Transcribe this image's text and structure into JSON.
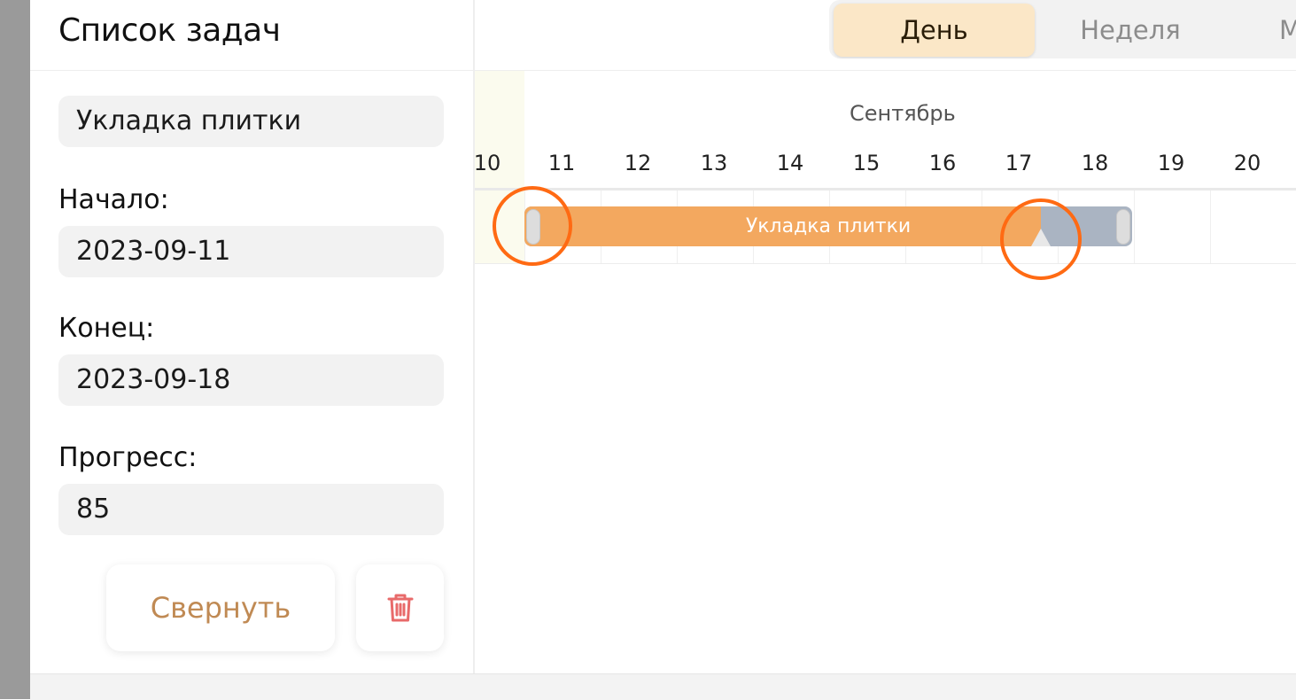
{
  "sidebar": {
    "title": "Список задач",
    "task_name": "Укладка плитки",
    "start_label": "Начало:",
    "start_value": "2023-09-11",
    "end_label": "Конец:",
    "end_value": "2023-09-18",
    "progress_label": "Прогресс:",
    "progress_value": "85",
    "collapse_label": "Свернуть",
    "delete_icon": "trash-icon"
  },
  "view_modes": {
    "day": "День",
    "week": "Неделя",
    "month_partial": "М",
    "active": "day"
  },
  "timeline": {
    "month": "Сентябрь",
    "days": [
      "10",
      "11",
      "12",
      "13",
      "14",
      "15",
      "16",
      "17",
      "18",
      "19",
      "20"
    ]
  },
  "task_bar": {
    "label": "Укладка плитки",
    "start": "2023-09-11",
    "end": "2023-09-18",
    "progress": 85
  },
  "colors": {
    "progress_fill": "#f3a85f",
    "bar_remaining": "#aab4c2",
    "active_view": "#fbe7c7",
    "collapse_text": "#c08a54",
    "delete_icon": "#e86a6a",
    "highlight_ring": "#ff6a13"
  }
}
